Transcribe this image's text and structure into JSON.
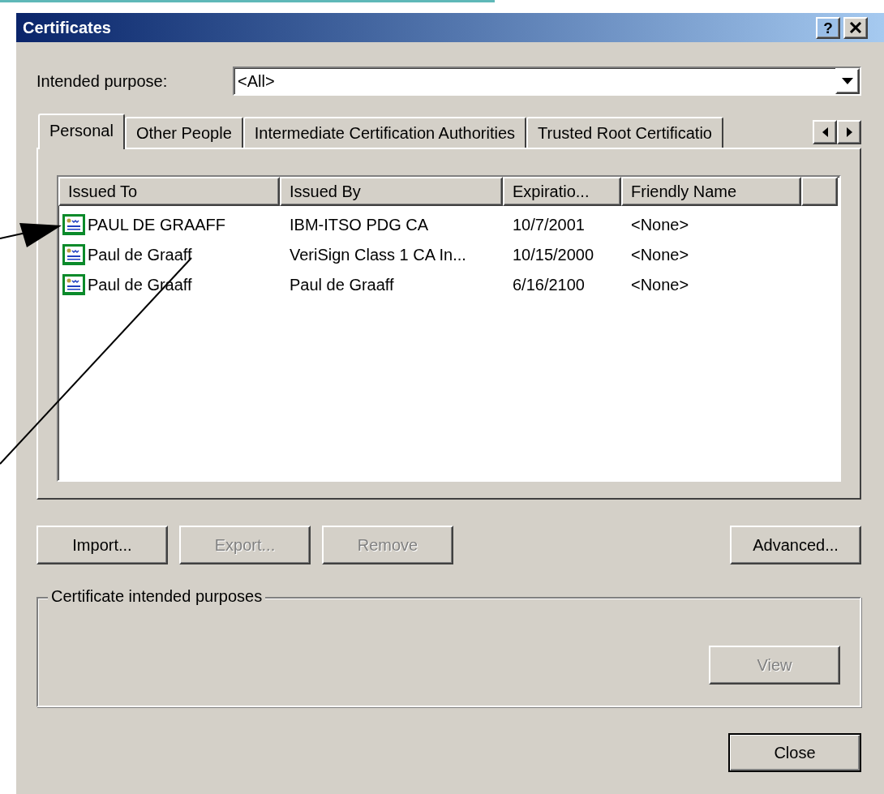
{
  "window": {
    "title": "Certificates",
    "help_button": "?"
  },
  "intended_purpose": {
    "label": "Intended purpose:",
    "value": "<All>"
  },
  "tabs": [
    {
      "label": "Personal",
      "selected": true
    },
    {
      "label": "Other People",
      "selected": false
    },
    {
      "label": "Intermediate Certification Authorities",
      "selected": false
    },
    {
      "label": "Trusted Root Certificatio",
      "selected": false
    }
  ],
  "table": {
    "columns": [
      "Issued To",
      "Issued By",
      "Expiratio...",
      "Friendly Name"
    ],
    "rows": [
      {
        "cells": [
          "PAUL DE GRAAFF",
          "IBM-ITSO PDG CA",
          "10/7/2001",
          "<None>"
        ]
      },
      {
        "cells": [
          "Paul de Graaff",
          "VeriSign Class 1 CA In...",
          "10/15/2000",
          "<None>"
        ]
      },
      {
        "cells": [
          "Paul de Graaff",
          "Paul de Graaff",
          "6/16/2100",
          "<None>"
        ]
      }
    ]
  },
  "buttons": [
    {
      "label": "Import...",
      "disabled": false
    },
    {
      "label": "Export...",
      "disabled": true
    },
    {
      "label": "Remove",
      "disabled": true
    },
    {
      "label": "Advanced...",
      "disabled": false
    }
  ],
  "purposes_group": {
    "title": "Certificate intended purposes",
    "view_button": {
      "label": "View",
      "disabled": true
    }
  },
  "close_button": {
    "label": "Close"
  }
}
